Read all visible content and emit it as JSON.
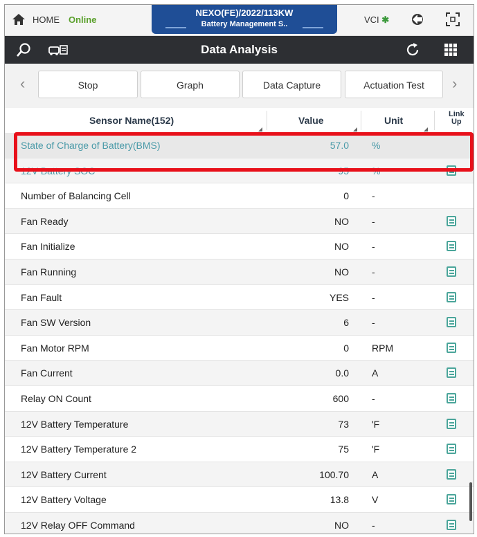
{
  "status": {
    "home_label": "HOME",
    "online_label": "Online",
    "vehicle_line1": "NEXO(FE)/2022/113KW",
    "vehicle_line2": "Battery Management S..",
    "vci_label": "VCI",
    "bt_glyph": "✱"
  },
  "titlebar": {
    "title": "Data Analysis"
  },
  "toolbar": {
    "prev_glyph": "‹",
    "next_glyph": "›",
    "buttons": [
      "Stop",
      "Graph",
      "Data Capture",
      "Actuation Test"
    ]
  },
  "table": {
    "headers": {
      "name": "Sensor Name(152)",
      "value": "Value",
      "unit": "Unit",
      "link": "Link Up"
    },
    "rows": [
      {
        "name": "State of Charge of Battery(BMS)",
        "value": "57.0",
        "unit": "%",
        "link": false
      },
      {
        "name": "12V Battery SOC",
        "value": "95",
        "unit": "%",
        "link": true
      },
      {
        "name": "Number of Balancing Cell",
        "value": "0",
        "unit": "-",
        "link": false
      },
      {
        "name": "Fan Ready",
        "value": "NO",
        "unit": "-",
        "link": true
      },
      {
        "name": "Fan Initialize",
        "value": "NO",
        "unit": "-",
        "link": true
      },
      {
        "name": "Fan Running",
        "value": "NO",
        "unit": "-",
        "link": true
      },
      {
        "name": "Fan Fault",
        "value": "YES",
        "unit": "-",
        "link": true
      },
      {
        "name": "Fan SW Version",
        "value": "6",
        "unit": "-",
        "link": true
      },
      {
        "name": "Fan Motor RPM",
        "value": "0",
        "unit": "RPM",
        "link": true
      },
      {
        "name": "Fan Current",
        "value": "0.0",
        "unit": "A",
        "link": true
      },
      {
        "name": "Relay ON Count",
        "value": "600",
        "unit": "-",
        "link": true
      },
      {
        "name": "12V Battery Temperature",
        "value": "73",
        "unit": "'F",
        "link": true
      },
      {
        "name": "12V Battery Temperature 2",
        "value": "75",
        "unit": "'F",
        "link": true
      },
      {
        "name": "12V Battery Current",
        "value": "100.70",
        "unit": "A",
        "link": true
      },
      {
        "name": "12V Battery Voltage",
        "value": "13.8",
        "unit": "V",
        "link": true
      },
      {
        "name": "12V Relay OFF Command",
        "value": "NO",
        "unit": "-",
        "link": true
      }
    ]
  },
  "colors": {
    "highlight_border": "#e8101a",
    "title_bg": "#2d2f33",
    "vehicle_bg": "#1f4e96",
    "online": "#5aa02c",
    "link_icon": "#4aa59a"
  }
}
